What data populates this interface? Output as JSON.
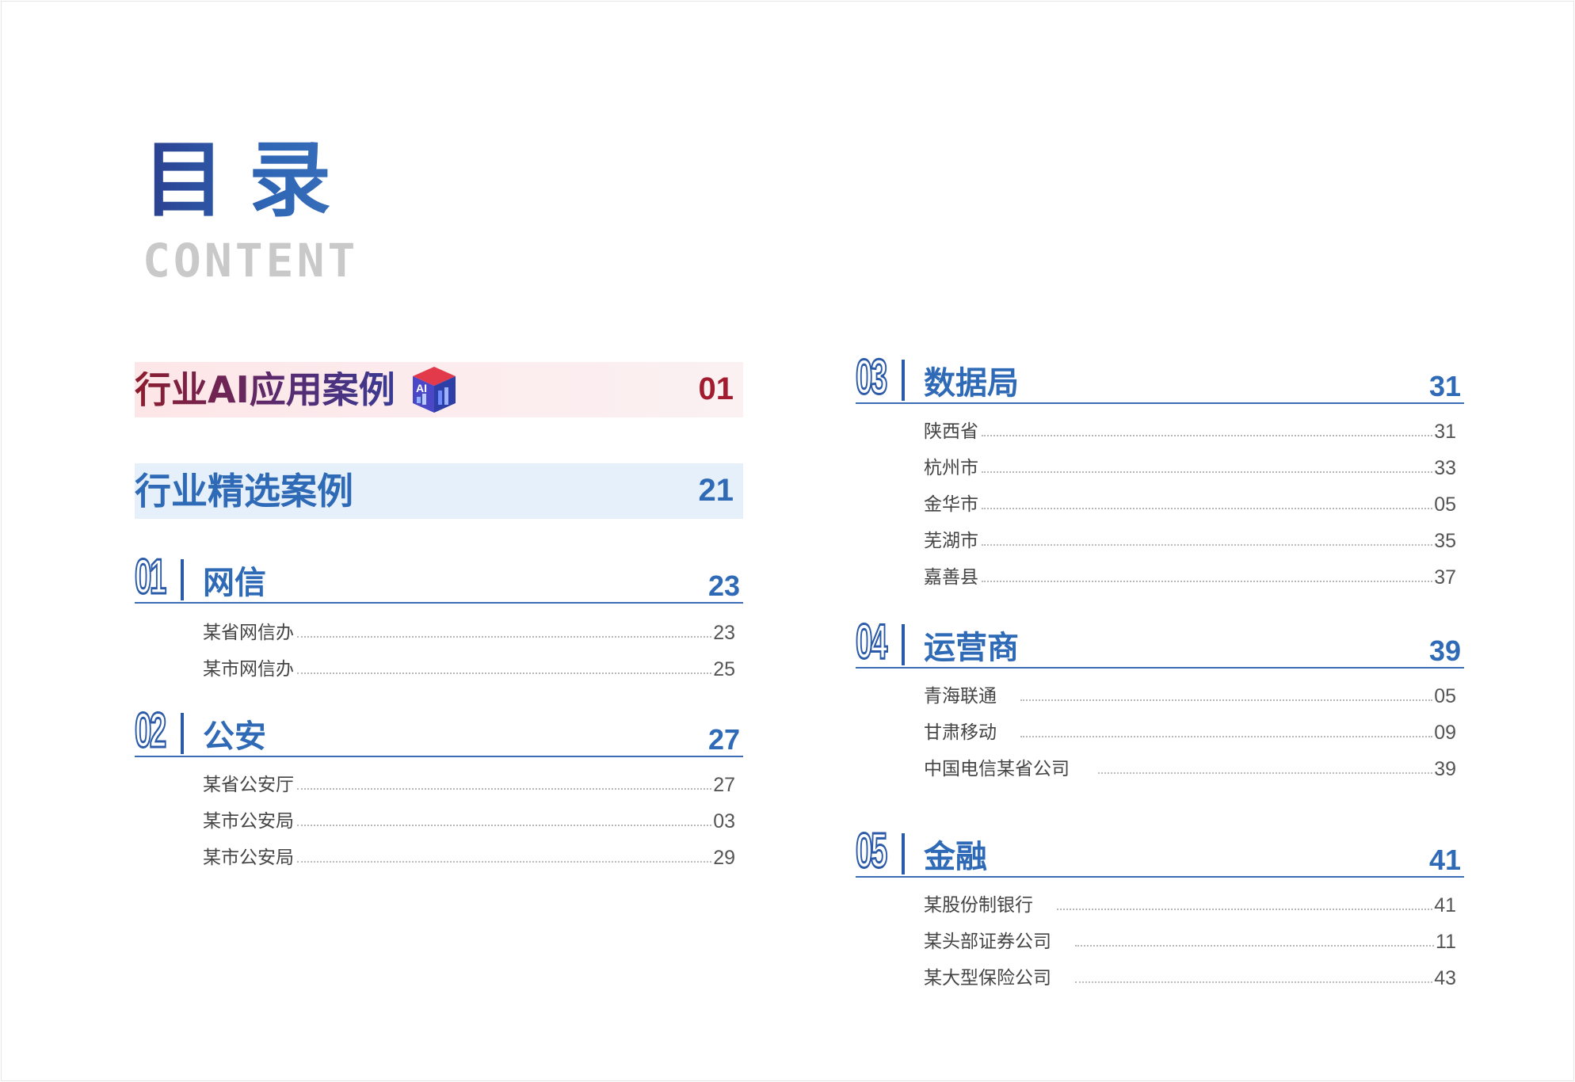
{
  "title": "目录",
  "subtitle": "CONTENT",
  "featured": [
    {
      "title": "行业AI应用案例",
      "page": "01",
      "icon": "ai-cube-icon",
      "badge": "AI"
    },
    {
      "title": "行业精选案例",
      "page": "21"
    }
  ],
  "sections": [
    {
      "num": "01",
      "title": "网信",
      "page": "23",
      "items": [
        {
          "label": "某省网信办",
          "page": "23"
        },
        {
          "label": "某市网信办",
          "page": "25"
        }
      ]
    },
    {
      "num": "02",
      "title": "公安",
      "page": "27",
      "items": [
        {
          "label": "某省公安厅",
          "page": "27"
        },
        {
          "label": "某市公安局",
          "page": "03"
        },
        {
          "label": "某市公安局",
          "page": "29"
        }
      ]
    },
    {
      "num": "03",
      "title": "数据局",
      "page": "31",
      "items": [
        {
          "label": "陕西省",
          "page": "31"
        },
        {
          "label": "杭州市",
          "page": "33"
        },
        {
          "label": "金华市",
          "page": "05"
        },
        {
          "label": "芜湖市",
          "page": "35"
        },
        {
          "label": "嘉善县",
          "page": "37"
        }
      ]
    },
    {
      "num": "04",
      "title": "运营商",
      "page": "39",
      "items": [
        {
          "label": "青海联通",
          "page": "05"
        },
        {
          "label": "甘肃移动",
          "page": "09"
        },
        {
          "label": "中国电信某省公司",
          "page": "39"
        }
      ]
    },
    {
      "num": "05",
      "title": "金融",
      "page": "41",
      "items": [
        {
          "label": "某股份制银行",
          "page": "41"
        },
        {
          "label": "某头部证券公司",
          "page": "11"
        },
        {
          "label": "某大型保险公司",
          "page": "43"
        }
      ]
    }
  ],
  "colors": {
    "accent": "#2f6ab7",
    "ai_red": "#a31b2e",
    "muted": "#c9c9c9"
  }
}
